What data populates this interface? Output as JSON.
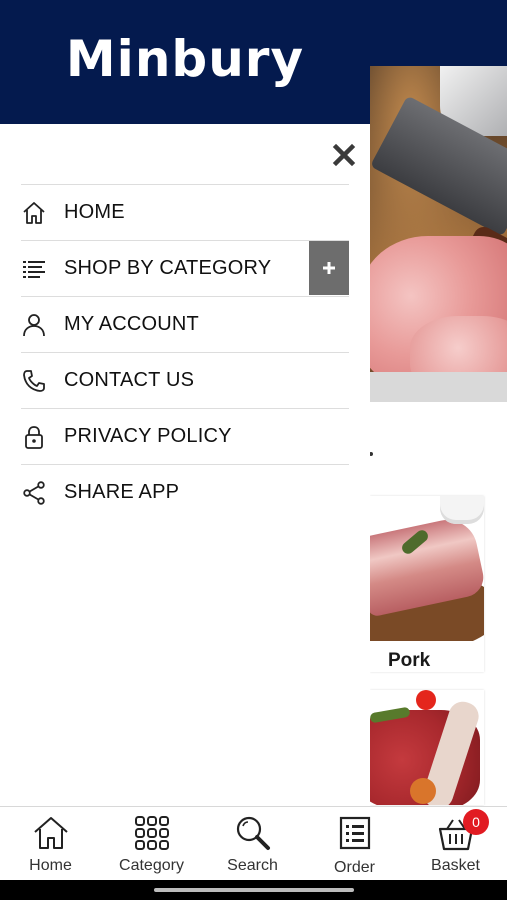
{
  "app": {
    "brand": "Minbury"
  },
  "drawer": {
    "close_icon": "close-icon",
    "menu": [
      {
        "label": "HOME",
        "icon": "home-icon"
      },
      {
        "label": "SHOP BY CATEGORY",
        "icon": "list-icon",
        "expand_symbol": "+"
      },
      {
        "label": "MY ACCOUNT",
        "icon": "user-icon"
      },
      {
        "label": "CONTACT US",
        "icon": "phone-icon"
      },
      {
        "label": "PRIVACY POLICY",
        "icon": "lock-icon"
      },
      {
        "label": "SHARE APP",
        "icon": "share-icon"
      }
    ]
  },
  "background_page": {
    "cards": [
      {
        "label": "Pork"
      },
      {
        "label": ""
      }
    ]
  },
  "bottom_nav": {
    "items": [
      {
        "label": "Home",
        "icon": "home-icon"
      },
      {
        "label": "Category",
        "icon": "grid-icon"
      },
      {
        "label": "Search",
        "icon": "search-icon"
      },
      {
        "label": "Order",
        "icon": "order-list-icon"
      },
      {
        "label": "Basket",
        "icon": "basket-icon",
        "badge": "0"
      }
    ]
  },
  "colors": {
    "header_navy": "#041a4e",
    "badge_red": "#e11b22",
    "expand_button_gray": "#6d6d6d"
  }
}
